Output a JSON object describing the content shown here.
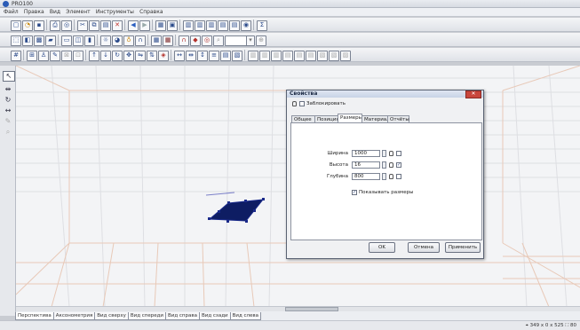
{
  "app": {
    "title": "PRO100"
  },
  "menu": [
    "Файл",
    "Правка",
    "Вид",
    "Элемент",
    "Инструменты",
    "Справка"
  ],
  "toolbar1": [
    "new-icon",
    "open-icon",
    "save-icon",
    "print-icon",
    "preview-icon",
    "cut-icon",
    "copy-icon",
    "paste-icon",
    "delete-icon",
    "undo-icon",
    "redo-icon",
    "properties-icon",
    "library-icon",
    "align-left-icon",
    "align-center-icon",
    "align-right-icon",
    "align-top-icon",
    "align-middle-icon",
    "refresh-icon",
    "sum-icon"
  ],
  "viewtabs": [
    "Перспектива",
    "Аксонометрия",
    "Вид сверху",
    "Вид спереди",
    "Вид справа",
    "Вид сзади",
    "Вид слева"
  ],
  "statusbar": {
    "coords": "⌖ 349 x 0 x 525  ⛶ 80"
  },
  "dialog": {
    "title": "Свойства",
    "close": "✕",
    "lock_label": "Заблокировать",
    "tabs": [
      "Общее",
      "Позиция",
      "Размеры",
      "Материал",
      "Отчёты"
    ],
    "active_tab": "Размеры",
    "fields": [
      {
        "label": "Ширина",
        "value": "1000",
        "checked": false
      },
      {
        "label": "Высота",
        "value": "16",
        "checked": true
      },
      {
        "label": "Глубина",
        "value": "800",
        "checked": false
      }
    ],
    "show_dims_label": "Показывать размеры",
    "show_dims_checked": true,
    "buttons": {
      "ok": "OK",
      "cancel": "Отмена",
      "apply": "Применить"
    }
  }
}
